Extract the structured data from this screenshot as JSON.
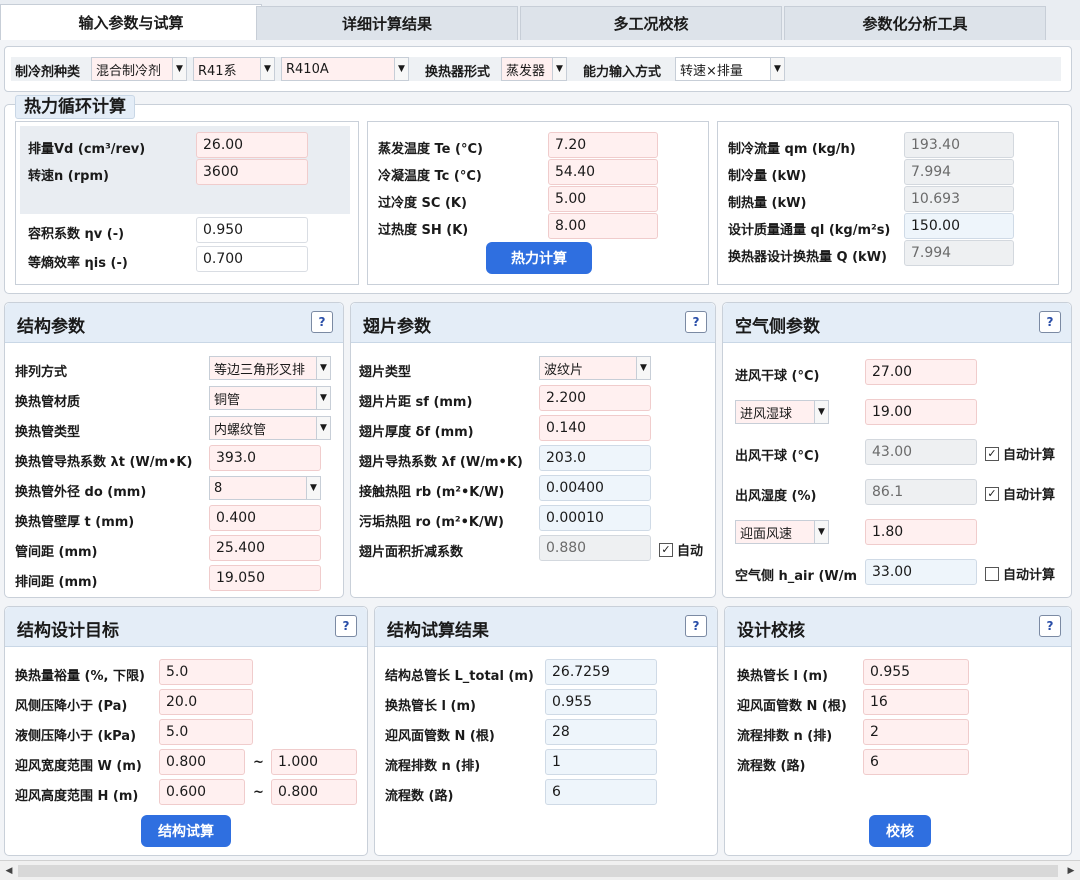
{
  "tabs": [
    "输入参数与试算",
    "详细计算结果",
    "多工况校核",
    "参数化分析工具"
  ],
  "top": {
    "refrigerant_label": "制冷剂种类",
    "refrigerant_type": "混合制冷剂",
    "refrigerant_series": "R41系",
    "refrigerant": "R410A",
    "hx_label": "换热器形式",
    "hx_type": "蒸发器",
    "capacity_label": "能力输入方式",
    "capacity_mode": "转速×排量"
  },
  "thermo": {
    "title": "热力循环计算",
    "vd_label": "排量Vd (cm³/rev)",
    "vd": "26.00",
    "n_label": "转速n (rpm)",
    "n": "3600",
    "eta_v_label": "容积系数 ηv (-)",
    "eta_v": "0.950",
    "eta_is_label": "等熵效率 ηis (-)",
    "eta_is": "0.700",
    "te_label": "蒸发温度 Te (°C)",
    "te": "7.20",
    "tc_label": "冷凝温度 Tc (°C)",
    "tc": "54.40",
    "sc_label": "过冷度 SC (K)",
    "sc": "5.00",
    "sh_label": "过热度 SH (K)",
    "sh": "8.00",
    "calc_button": "热力计算",
    "qm_label": "制冷流量 qm (kg/h)",
    "qm": "193.40",
    "qc_label": "制冷量 (kW)",
    "qc": "7.994",
    "qh_label": "制热量 (kW)",
    "qh": "10.693",
    "ql_label": "设计质量通量 ql (kg/m²s)",
    "ql": "150.00",
    "q_label": "换热器设计换热量 Q (kW)",
    "q": "7.994"
  },
  "structure": {
    "title": "结构参数",
    "help": "?",
    "rows": [
      {
        "label": "排列方式",
        "value": "等边三角形叉排"
      },
      {
        "label": "换热管材质",
        "value": "铜管"
      },
      {
        "label": "换热管类型",
        "value": "内螺纹管"
      },
      {
        "label": "换热管导热系数 λt (W/m•K)",
        "value": "393.0"
      },
      {
        "label": "换热管外径 do (mm)",
        "value": "8"
      },
      {
        "label": "换热管壁厚 t (mm)",
        "value": "0.400"
      },
      {
        "label": "管间距 (mm)",
        "value": "25.400"
      },
      {
        "label": "排间距 (mm)",
        "value": "19.050"
      }
    ]
  },
  "fin": {
    "title": "翅片参数",
    "help": "?",
    "rows": [
      {
        "label": "翅片类型",
        "value": "波纹片"
      },
      {
        "label": "翅片片距 sf (mm)",
        "value": "2.200"
      },
      {
        "label": "翅片厚度 δf (mm)",
        "value": "0.140"
      },
      {
        "label": "翅片导热系数 λf (W/m•K)",
        "value": "203.0"
      },
      {
        "label": "接触热阻 rb (m²•K/W)",
        "value": "0.00400"
      },
      {
        "label": "污垢热阻 ro (m²•K/W)",
        "value": "0.00010"
      },
      {
        "label": "翅片面积折减系数",
        "value": "0.880"
      }
    ],
    "auto_label": "自动"
  },
  "air": {
    "title": "空气侧参数",
    "help": "?",
    "in_dry_label": "进风干球 (°C)",
    "in_dry": "27.00",
    "in_wet_label": "进风湿球",
    "in_wet": "19.00",
    "out_dry_label": "出风干球 (°C)",
    "out_dry": "43.00",
    "out_rh_label": "出风湿度 (%)",
    "out_rh": "86.1",
    "face_label": "迎面风速",
    "face": "1.80",
    "hair_label": "空气侧 h_air (W/m",
    "hair": "33.00",
    "auto_label": "自动计算"
  },
  "target": {
    "title": "结构设计目标",
    "help": "?",
    "margin_label": "换热量裕量 (%, 下限)",
    "margin": "5.0",
    "air_dp_label": "风侧压降小于 (Pa)",
    "air_dp": "20.0",
    "liq_dp_label": "液侧压降小于 (kPa)",
    "liq_dp": "5.0",
    "w_label": "迎风宽度范围 W (m)",
    "w_min": "0.800",
    "w_max": "1.000",
    "h_label": "迎风高度范围 H (m)",
    "h_min": "0.600",
    "h_max": "0.800",
    "tilde": "~",
    "button": "结构试算"
  },
  "trial": {
    "title": "结构试算结果",
    "help": "?",
    "rows": [
      {
        "label": "结构总管长 L_total (m)",
        "value": "26.7259"
      },
      {
        "label": "换热管长 l (m)",
        "value": "0.955"
      },
      {
        "label": "迎风面管数 N (根)",
        "value": "28"
      },
      {
        "label": "流程排数 n (排)",
        "value": "1"
      },
      {
        "label": "流程数 (路)",
        "value": "6"
      }
    ]
  },
  "check": {
    "title": "设计校核",
    "help": "?",
    "rows": [
      {
        "label": "换热管长 l (m)",
        "value": "0.955"
      },
      {
        "label": "迎风面管数 N (根)",
        "value": "16"
      },
      {
        "label": "流程排数 n (排)",
        "value": "2"
      },
      {
        "label": "流程数 (路)",
        "value": "6"
      }
    ],
    "button": "校核"
  },
  "colors": {
    "accent": "#2f6fe0",
    "required_field": "#fff0f0",
    "panel_header": "#e4edf7"
  }
}
